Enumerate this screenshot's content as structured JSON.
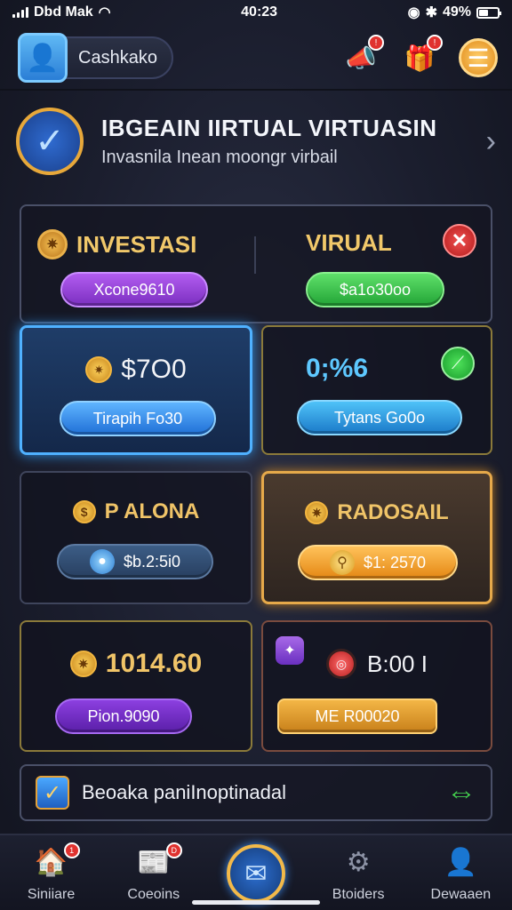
{
  "status_bar": {
    "carrier": "Dbd Mak",
    "time": "40:23",
    "battery": "49%"
  },
  "header": {
    "username": "Cashkako"
  },
  "banner": {
    "title": "IBGEAIN IIRTUAL VIRTUASIN",
    "subtitle": "Invasnila Inean moongr virbail"
  },
  "top_panel": {
    "left": {
      "title": "INVESTASI",
      "value": "Xcone9610"
    },
    "right": {
      "title": "VIRUAL",
      "value": "$a1o30oo"
    }
  },
  "cards": [
    {
      "title": "$7O0",
      "button": "Tirapih Fo30"
    },
    {
      "title": "0;%6",
      "button": "Tytans Go0o"
    },
    {
      "title": "P ALONA",
      "button": "$b.2:5i0"
    },
    {
      "title": "RADOSAIL",
      "button": "$1: 2570"
    },
    {
      "title": "1014.60",
      "button": "Pion.9090"
    },
    {
      "title": "B:00 I",
      "button": "ME R00020"
    }
  ],
  "footer": {
    "text": "Beoaka paniInoptinadal"
  },
  "tabs": [
    {
      "label": "Siniiare",
      "icon": "home-icon"
    },
    {
      "label": "Coeoins",
      "icon": "document-icon"
    },
    {
      "label": "",
      "icon": "mail-icon"
    },
    {
      "label": "Btoiders",
      "icon": "gear-icon"
    },
    {
      "label": "Dewaaen",
      "icon": "person-icon"
    }
  ]
}
